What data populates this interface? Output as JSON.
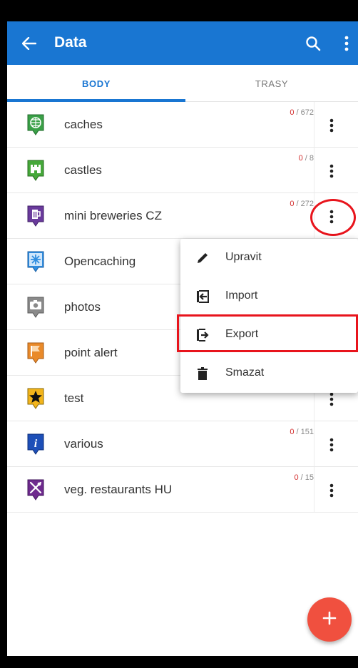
{
  "toolbar": {
    "title": "Data",
    "back_icon": "arrow-left-icon",
    "search_icon": "search-icon",
    "more_icon": "more-vert-icon",
    "color": "#1976d2"
  },
  "tabs": [
    {
      "label": "BODY",
      "active": true
    },
    {
      "label": "TRASY",
      "active": false
    }
  ],
  "list": [
    {
      "name": "caches",
      "visible": "0",
      "total": "/ 672",
      "icon": "globe-icon",
      "color": "#3aa047"
    },
    {
      "name": "castles",
      "visible": "0",
      "total": "/ 8",
      "icon": "castle-icon",
      "color": "#46a83a"
    },
    {
      "name": "mini breweries CZ",
      "visible": "0",
      "total": "/ 272",
      "icon": "beer-icon",
      "color": "#6a3a9c"
    },
    {
      "name": "Opencaching",
      "visible": "",
      "total": "",
      "icon": "star-burst-icon",
      "color": "#2f8de0"
    },
    {
      "name": "photos",
      "visible": "",
      "total": "",
      "icon": "camera-icon",
      "color": "#8a8a8a"
    },
    {
      "name": "point alert",
      "visible": "",
      "total": "",
      "icon": "flag-icon",
      "color": "#e98a2a"
    },
    {
      "name": "test",
      "visible": "",
      "total": "",
      "icon": "star-icon",
      "color": "#f3b51b"
    },
    {
      "name": "various",
      "visible": "0",
      "total": "/ 151",
      "icon": "info-icon",
      "color": "#1d4fb8"
    },
    {
      "name": "veg. restaurants HU",
      "visible": "0",
      "total": "/ 15",
      "icon": "cutlery-icon",
      "color": "#6f2a8e"
    }
  ],
  "popup_menu": [
    {
      "label": "Upravit",
      "icon": "pencil-icon"
    },
    {
      "label": "Import",
      "icon": "import-icon"
    },
    {
      "label": "Export",
      "icon": "export-icon"
    },
    {
      "label": "Smazat",
      "icon": "trash-icon"
    }
  ],
  "fab": {
    "icon": "plus-icon",
    "color": "#f0503f"
  },
  "highlight_color": "#e8141c"
}
